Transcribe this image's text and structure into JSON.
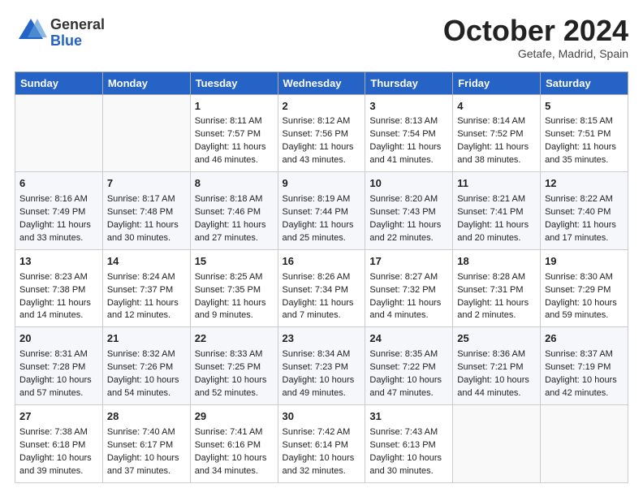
{
  "header": {
    "logo_general": "General",
    "logo_blue": "Blue",
    "month": "October 2024",
    "location": "Getafe, Madrid, Spain"
  },
  "weekdays": [
    "Sunday",
    "Monday",
    "Tuesday",
    "Wednesday",
    "Thursday",
    "Friday",
    "Saturday"
  ],
  "weeks": [
    [
      {
        "day": "",
        "sunrise": "",
        "sunset": "",
        "daylight": ""
      },
      {
        "day": "",
        "sunrise": "",
        "sunset": "",
        "daylight": ""
      },
      {
        "day": "1",
        "sunrise": "Sunrise: 8:11 AM",
        "sunset": "Sunset: 7:57 PM",
        "daylight": "Daylight: 11 hours and 46 minutes."
      },
      {
        "day": "2",
        "sunrise": "Sunrise: 8:12 AM",
        "sunset": "Sunset: 7:56 PM",
        "daylight": "Daylight: 11 hours and 43 minutes."
      },
      {
        "day": "3",
        "sunrise": "Sunrise: 8:13 AM",
        "sunset": "Sunset: 7:54 PM",
        "daylight": "Daylight: 11 hours and 41 minutes."
      },
      {
        "day": "4",
        "sunrise": "Sunrise: 8:14 AM",
        "sunset": "Sunset: 7:52 PM",
        "daylight": "Daylight: 11 hours and 38 minutes."
      },
      {
        "day": "5",
        "sunrise": "Sunrise: 8:15 AM",
        "sunset": "Sunset: 7:51 PM",
        "daylight": "Daylight: 11 hours and 35 minutes."
      }
    ],
    [
      {
        "day": "6",
        "sunrise": "Sunrise: 8:16 AM",
        "sunset": "Sunset: 7:49 PM",
        "daylight": "Daylight: 11 hours and 33 minutes."
      },
      {
        "day": "7",
        "sunrise": "Sunrise: 8:17 AM",
        "sunset": "Sunset: 7:48 PM",
        "daylight": "Daylight: 11 hours and 30 minutes."
      },
      {
        "day": "8",
        "sunrise": "Sunrise: 8:18 AM",
        "sunset": "Sunset: 7:46 PM",
        "daylight": "Daylight: 11 hours and 27 minutes."
      },
      {
        "day": "9",
        "sunrise": "Sunrise: 8:19 AM",
        "sunset": "Sunset: 7:44 PM",
        "daylight": "Daylight: 11 hours and 25 minutes."
      },
      {
        "day": "10",
        "sunrise": "Sunrise: 8:20 AM",
        "sunset": "Sunset: 7:43 PM",
        "daylight": "Daylight: 11 hours and 22 minutes."
      },
      {
        "day": "11",
        "sunrise": "Sunrise: 8:21 AM",
        "sunset": "Sunset: 7:41 PM",
        "daylight": "Daylight: 11 hours and 20 minutes."
      },
      {
        "day": "12",
        "sunrise": "Sunrise: 8:22 AM",
        "sunset": "Sunset: 7:40 PM",
        "daylight": "Daylight: 11 hours and 17 minutes."
      }
    ],
    [
      {
        "day": "13",
        "sunrise": "Sunrise: 8:23 AM",
        "sunset": "Sunset: 7:38 PM",
        "daylight": "Daylight: 11 hours and 14 minutes."
      },
      {
        "day": "14",
        "sunrise": "Sunrise: 8:24 AM",
        "sunset": "Sunset: 7:37 PM",
        "daylight": "Daylight: 11 hours and 12 minutes."
      },
      {
        "day": "15",
        "sunrise": "Sunrise: 8:25 AM",
        "sunset": "Sunset: 7:35 PM",
        "daylight": "Daylight: 11 hours and 9 minutes."
      },
      {
        "day": "16",
        "sunrise": "Sunrise: 8:26 AM",
        "sunset": "Sunset: 7:34 PM",
        "daylight": "Daylight: 11 hours and 7 minutes."
      },
      {
        "day": "17",
        "sunrise": "Sunrise: 8:27 AM",
        "sunset": "Sunset: 7:32 PM",
        "daylight": "Daylight: 11 hours and 4 minutes."
      },
      {
        "day": "18",
        "sunrise": "Sunrise: 8:28 AM",
        "sunset": "Sunset: 7:31 PM",
        "daylight": "Daylight: 11 hours and 2 minutes."
      },
      {
        "day": "19",
        "sunrise": "Sunrise: 8:30 AM",
        "sunset": "Sunset: 7:29 PM",
        "daylight": "Daylight: 10 hours and 59 minutes."
      }
    ],
    [
      {
        "day": "20",
        "sunrise": "Sunrise: 8:31 AM",
        "sunset": "Sunset: 7:28 PM",
        "daylight": "Daylight: 10 hours and 57 minutes."
      },
      {
        "day": "21",
        "sunrise": "Sunrise: 8:32 AM",
        "sunset": "Sunset: 7:26 PM",
        "daylight": "Daylight: 10 hours and 54 minutes."
      },
      {
        "day": "22",
        "sunrise": "Sunrise: 8:33 AM",
        "sunset": "Sunset: 7:25 PM",
        "daylight": "Daylight: 10 hours and 52 minutes."
      },
      {
        "day": "23",
        "sunrise": "Sunrise: 8:34 AM",
        "sunset": "Sunset: 7:23 PM",
        "daylight": "Daylight: 10 hours and 49 minutes."
      },
      {
        "day": "24",
        "sunrise": "Sunrise: 8:35 AM",
        "sunset": "Sunset: 7:22 PM",
        "daylight": "Daylight: 10 hours and 47 minutes."
      },
      {
        "day": "25",
        "sunrise": "Sunrise: 8:36 AM",
        "sunset": "Sunset: 7:21 PM",
        "daylight": "Daylight: 10 hours and 44 minutes."
      },
      {
        "day": "26",
        "sunrise": "Sunrise: 8:37 AM",
        "sunset": "Sunset: 7:19 PM",
        "daylight": "Daylight: 10 hours and 42 minutes."
      }
    ],
    [
      {
        "day": "27",
        "sunrise": "Sunrise: 7:38 AM",
        "sunset": "Sunset: 6:18 PM",
        "daylight": "Daylight: 10 hours and 39 minutes."
      },
      {
        "day": "28",
        "sunrise": "Sunrise: 7:40 AM",
        "sunset": "Sunset: 6:17 PM",
        "daylight": "Daylight: 10 hours and 37 minutes."
      },
      {
        "day": "29",
        "sunrise": "Sunrise: 7:41 AM",
        "sunset": "Sunset: 6:16 PM",
        "daylight": "Daylight: 10 hours and 34 minutes."
      },
      {
        "day": "30",
        "sunrise": "Sunrise: 7:42 AM",
        "sunset": "Sunset: 6:14 PM",
        "daylight": "Daylight: 10 hours and 32 minutes."
      },
      {
        "day": "31",
        "sunrise": "Sunrise: 7:43 AM",
        "sunset": "Sunset: 6:13 PM",
        "daylight": "Daylight: 10 hours and 30 minutes."
      },
      {
        "day": "",
        "sunrise": "",
        "sunset": "",
        "daylight": ""
      },
      {
        "day": "",
        "sunrise": "",
        "sunset": "",
        "daylight": ""
      }
    ]
  ]
}
